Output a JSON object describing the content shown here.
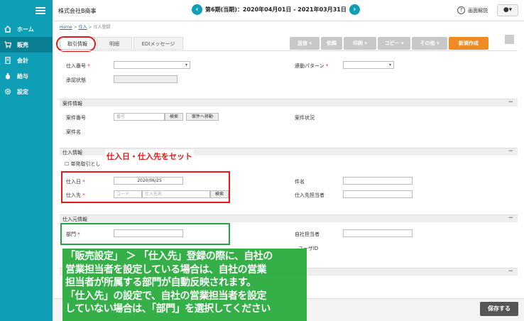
{
  "header": {
    "company": "株式会社B商事",
    "period": "第6期(当期)：2020年04月01日 - 2021年03月31日",
    "prev_icon": "chevron-left-icon",
    "next_icon": "chevron-right-icon",
    "help_label": "画面解説",
    "user_icon": "user-icon"
  },
  "sidebar": {
    "items": [
      {
        "label": "ホーム",
        "icon": "home-icon"
      },
      {
        "label": "販売",
        "icon": "cart-icon"
      },
      {
        "label": "会計",
        "icon": "ledger-icon"
      },
      {
        "label": "給与",
        "icon": "money-bag-icon"
      },
      {
        "label": "設定",
        "icon": "gear-icon"
      }
    ],
    "active": "販売"
  },
  "breadcrumb": {
    "home": "Home",
    "sep1": ">",
    "purchase": "仕入",
    "sep2": ">",
    "current": "仕入登録"
  },
  "tabs": [
    "取引情報",
    "明細",
    "EDIメッセージ"
  ],
  "actions": [
    "送信 ▾",
    "依頼",
    "印刷 ▾",
    "コピー ▾",
    "その他 ▾",
    "新規作成"
  ],
  "form": {
    "purchase_no_label": "仕入番号",
    "approval_label": "承認状態",
    "linked_pattern_label": "連動パターン",
    "req_mark": "*"
  },
  "case_section": {
    "title": "案件情報",
    "collapse": "−",
    "case_no_label": "案件番号",
    "case_no_placeholder": "番号",
    "search_btn": "検索",
    "goto_btn": "案件へ移動",
    "case_status_label": "案件状況",
    "case_name_label": "案件名"
  },
  "purchase_section": {
    "title": "仕入情報",
    "collapse": "−",
    "oneoff_label": "単発取引とし",
    "date_label": "仕入日",
    "date_value": "2020/06/25",
    "supplier_label": "仕入先",
    "code_placeholder": "コード",
    "name_placeholder": "仕入先名",
    "search_btn": "検索",
    "subject_label": "件名",
    "contact_label": "仕入先担当者"
  },
  "origin_section": {
    "title": "仕入元情報",
    "collapse": "−",
    "dept_label": "部門",
    "staff_label": "自社担当者",
    "user_id_label": "ユーザID"
  },
  "annotation_red": "仕入日・仕入先をセット",
  "annotation_green": [
    "「販売設定」 ＞ 「仕入先」登録の際に、自社の",
    "営業担当者を設定している場合は、自社の営業",
    "担当者が所属する部門が自動反映されます。",
    "「仕入先」の設定で、自社の営業担当者を設定",
    "していない場合は、「部門」を選択してください"
  ],
  "save_btn": "保存する"
}
